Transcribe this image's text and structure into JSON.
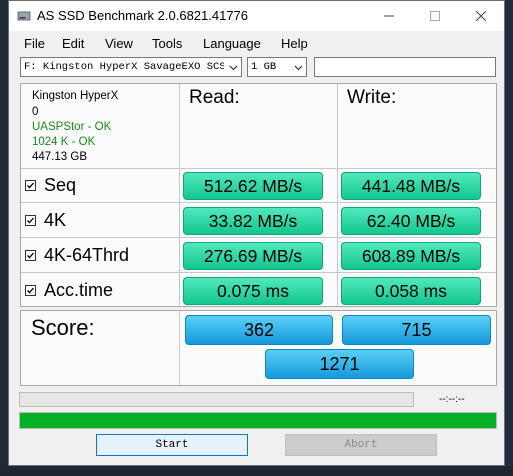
{
  "window": {
    "title": "AS SSD Benchmark 2.0.6821.41776"
  },
  "menu": [
    "File",
    "Edit",
    "View",
    "Tools",
    "Language",
    "Help"
  ],
  "toolbar": {
    "drive_select": "F: Kingston HyperX SavageEXO SCSI",
    "size_select": "1 GB",
    "text_field": ""
  },
  "drive_info": {
    "name": "Kingston HyperX",
    "id": "0",
    "driver_status": "UASPStor - OK",
    "alignment_status": "1024 K - OK",
    "capacity": "447.13 GB"
  },
  "headers": {
    "read": "Read:",
    "write": "Write:"
  },
  "tests": [
    {
      "label": "Seq",
      "checked": true,
      "read": "512.62 MB/s",
      "write": "441.48 MB/s"
    },
    {
      "label": "4K",
      "checked": true,
      "read": "33.82 MB/s",
      "write": "62.40 MB/s"
    },
    {
      "label": "4K-64Thrd",
      "checked": true,
      "read": "276.69 MB/s",
      "write": "608.89 MB/s"
    },
    {
      "label": "Acc.time",
      "checked": true,
      "read": "0.075 ms",
      "write": "0.058 ms"
    }
  ],
  "score": {
    "label": "Score:",
    "read": "362",
    "write": "715",
    "total": "1271"
  },
  "status": {
    "timer": "--:--:--",
    "progress": 1.0
  },
  "buttons": {
    "start": "Start",
    "abort": "Abort"
  },
  "colors": {
    "result_green": "#2ad8a3",
    "score_blue": "#33b4ec",
    "progress_green": "#06b025",
    "ok_green": "#1d8a1d"
  }
}
